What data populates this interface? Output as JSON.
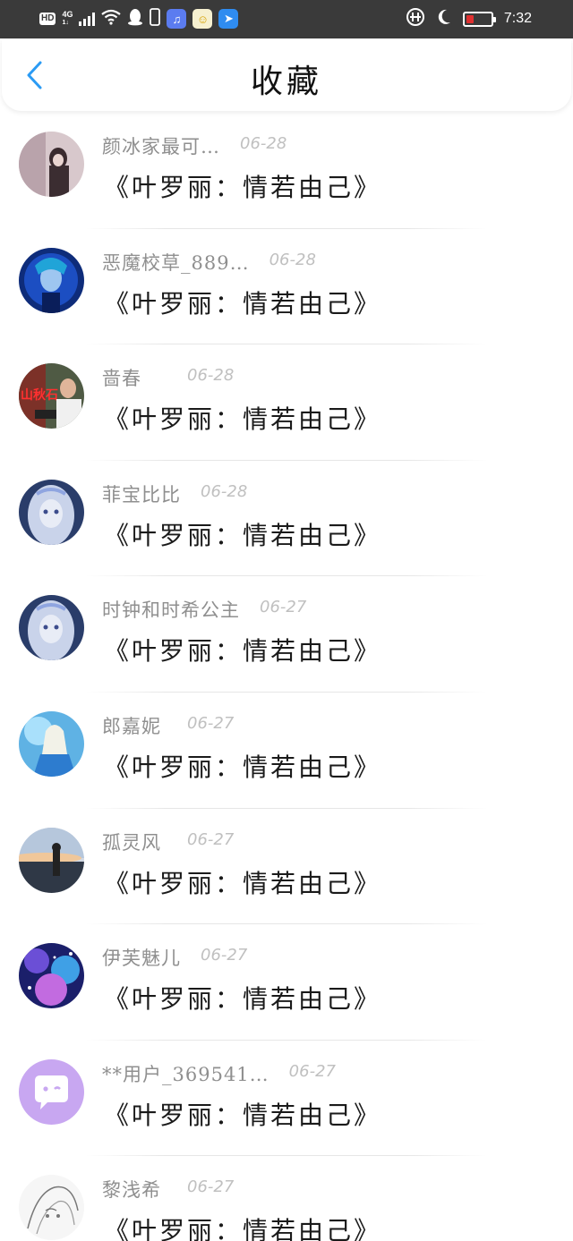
{
  "status_bar": {
    "hd": "HD",
    "network": "4G",
    "network_sub": "1↓",
    "time": "7:32",
    "battery_level": 0.3
  },
  "header": {
    "title": "收藏",
    "accent_color": "#2b9bf4"
  },
  "favorites": [
    {
      "user": "颜冰家最可…",
      "date": "06-28",
      "book": "《叶罗丽：情若由己》",
      "avatar_icon": "girl-photo-avatar"
    },
    {
      "user": "恶魔校草_889…",
      "date": "06-28",
      "book": "《叶罗丽：情若由己》",
      "avatar_icon": "anime-blue-avatar"
    },
    {
      "user": "啬春",
      "date": "06-28",
      "book": "《叶罗丽：情若由己》",
      "avatar_icon": "photo-avatar"
    },
    {
      "user": "菲宝比比",
      "date": "06-28",
      "book": "《叶罗丽：情若由己》",
      "avatar_icon": "anime-doll-avatar"
    },
    {
      "user": "时钟和时希公主",
      "date": "06-27",
      "book": "《叶罗丽：情若由己》",
      "avatar_icon": "anime-doll-avatar"
    },
    {
      "user": "郎嘉妮",
      "date": "06-27",
      "book": "《叶罗丽：情若由己》",
      "avatar_icon": "ice-princess-avatar"
    },
    {
      "user": "孤灵风",
      "date": "06-27",
      "book": "《叶罗丽：情若由己》",
      "avatar_icon": "sunset-avatar"
    },
    {
      "user": "伊芙魅儿",
      "date": "06-27",
      "book": "《叶罗丽：情若由己》",
      "avatar_icon": "galaxy-avatar"
    },
    {
      "user": "**用户_369541…",
      "date": "06-27",
      "book": "《叶罗丽：情若由己》",
      "avatar_icon": "chat-bubble-avatar"
    },
    {
      "user": "黎浅希",
      "date": "06-27",
      "book": "《叶罗丽：情若由己》",
      "avatar_icon": "sketch-avatar"
    }
  ]
}
